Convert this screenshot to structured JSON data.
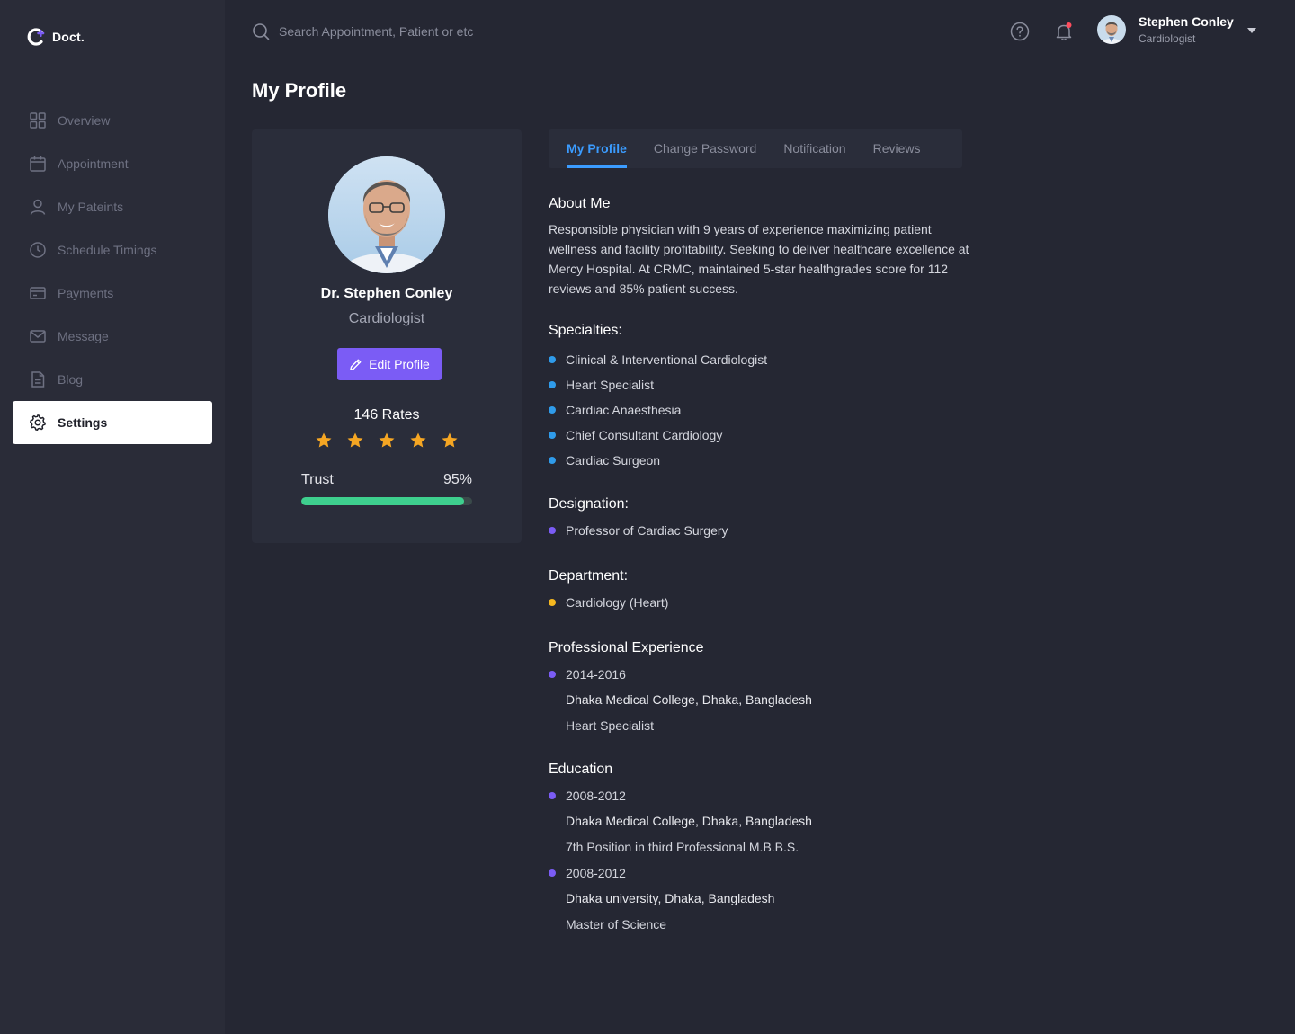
{
  "app": {
    "logo_text": "Doct."
  },
  "sidebar": {
    "items": [
      {
        "label": "Overview",
        "icon": "grid-icon"
      },
      {
        "label": "Appointment",
        "icon": "calendar-icon"
      },
      {
        "label": "My Pateints",
        "icon": "user-icon"
      },
      {
        "label": "Schedule Timings",
        "icon": "clock-icon"
      },
      {
        "label": "Payments",
        "icon": "card-icon"
      },
      {
        "label": "Message",
        "icon": "mail-icon"
      },
      {
        "label": "Blog",
        "icon": "document-icon"
      },
      {
        "label": "Settings",
        "icon": "gear-icon"
      }
    ],
    "active_index": 7
  },
  "header": {
    "search_placeholder": "Search Appointment, Patient or etc",
    "user_name": "Stephen Conley",
    "user_role": "Cardiologist"
  },
  "page": {
    "title": "My Profile"
  },
  "profile_card": {
    "name": "Dr.  Stephen Conley",
    "role": "Cardiologist",
    "edit_label": "Edit Profile",
    "rates_label": "146 Rates",
    "stars": 5,
    "trust_label": "Trust",
    "trust_value": "95%",
    "trust_percent": 95
  },
  "tabs": [
    "My Profile",
    "Change Password",
    "Notification",
    "Reviews"
  ],
  "about": {
    "title": "About Me",
    "text": "Responsible physician with 9 years of experience maximizing patient wellness and facility profitability. Seeking to deliver healthcare excellence at Mercy Hospital. At CRMC, maintained 5-star healthgrades score for 112 reviews and 85% patient success."
  },
  "specialties": {
    "title": "Specialties:",
    "items": [
      "Clinical & Interventional Cardiologist",
      "Heart Specialist",
      "Cardiac Anaesthesia",
      "Chief Consultant Cardiology",
      "Cardiac Surgeon"
    ]
  },
  "designation": {
    "title": "Designation:",
    "items": [
      "Professor of Cardiac Surgery"
    ]
  },
  "department": {
    "title": "Department:",
    "items": [
      "Cardiology (Heart)"
    ]
  },
  "experience": {
    "title": "Professional Experience",
    "items": [
      {
        "years": "2014-2016",
        "place": "Dhaka Medical College, Dhaka, Bangladesh",
        "detail": "Heart Specialist"
      }
    ]
  },
  "education": {
    "title": "Education",
    "items": [
      {
        "years": "2008-2012",
        "place": "Dhaka Medical College, Dhaka, Bangladesh",
        "detail": "7th Position in third Professional M.B.B.S."
      },
      {
        "years": "2008-2012",
        "place": "Dhaka university, Dhaka, Bangladesh",
        "detail": "Master of Science"
      }
    ]
  },
  "colors": {
    "accent": "#7b5cf5",
    "tab_active": "#3b9cff",
    "specialty_dot": "#2f9bea",
    "designation_dot": "#7b5cf5",
    "department_dot": "#f5b71f",
    "trust_bar": "#3ecf8e",
    "star": "#f5a623"
  }
}
